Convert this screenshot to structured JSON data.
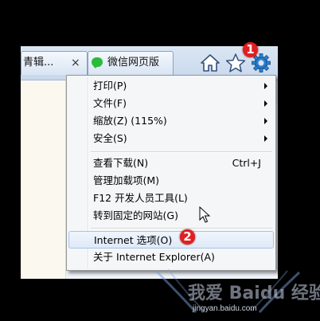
{
  "tabs": [
    {
      "label": "青辑...",
      "close": "×"
    },
    {
      "label": "微信网页版"
    }
  ],
  "toolbar": {
    "icons": [
      "home-icon",
      "star-icon",
      "gear-icon"
    ]
  },
  "menu": {
    "items": [
      {
        "label": "打印(P)",
        "submenu": true
      },
      {
        "label": "文件(F)",
        "submenu": true
      },
      {
        "label": "缩放(Z) (115%)",
        "submenu": true
      },
      {
        "label": "安全(S)",
        "submenu": true
      },
      {
        "label": "查看下载(N)",
        "shortcut": "Ctrl+J"
      },
      {
        "label": "管理加载项(M)"
      },
      {
        "label": "F12 开发人员工具(L)"
      },
      {
        "label": "转到固定的网站(G)"
      },
      {
        "label": "Internet 选项(O)",
        "highlighted": true
      },
      {
        "label": "关于 Internet Explorer(A)"
      }
    ]
  },
  "annotations": {
    "step1": "1",
    "step2": "2"
  },
  "watermark": {
    "logo": "我爱 Baidu 经验",
    "url": "jingyan.baidu.com"
  },
  "colors": {
    "badge": "#e02020",
    "highlight": "#dfeaf8",
    "gear": "#2a7fd4"
  }
}
